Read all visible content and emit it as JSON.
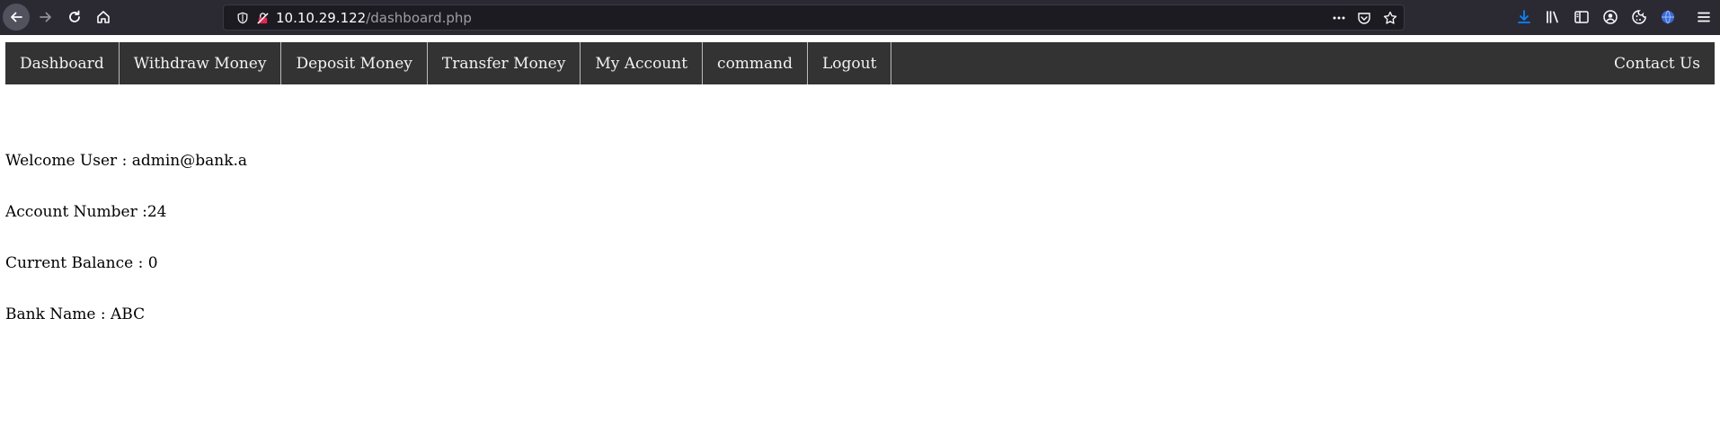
{
  "browser": {
    "url_host": "10.10.29.122",
    "url_path": "/dashboard.php",
    "icons": {
      "back": "back-arrow-icon",
      "forward": "forward-arrow-icon",
      "reload": "reload-icon",
      "home": "home-icon",
      "shield": "tracking-shield-icon",
      "insecure": "insecure-lock-icon",
      "more": "more-dots-icon",
      "pocket": "pocket-icon",
      "bookmark": "bookmark-star-icon",
      "download": "download-icon",
      "library": "library-icon",
      "sidebar": "sidebar-icon",
      "account": "account-icon",
      "cookie": "cookie-icon",
      "globe": "globe-extension-icon",
      "menu": "hamburger-menu-icon"
    },
    "accent_color": "#0a84ff"
  },
  "nav": {
    "items": [
      {
        "label": "Dashboard"
      },
      {
        "label": "Withdraw Money"
      },
      {
        "label": "Deposit Money"
      },
      {
        "label": "Transfer Money"
      },
      {
        "label": "My Account"
      },
      {
        "label": "command"
      },
      {
        "label": "Logout"
      }
    ],
    "right_item": {
      "label": "Contact Us"
    },
    "bg_color": "#333333"
  },
  "account_info": {
    "welcome": "Welcome User : admin@bank.a",
    "account_number": "Account Number :24",
    "current_balance": "Current Balance : 0",
    "bank_name": "Bank Name : ABC"
  }
}
